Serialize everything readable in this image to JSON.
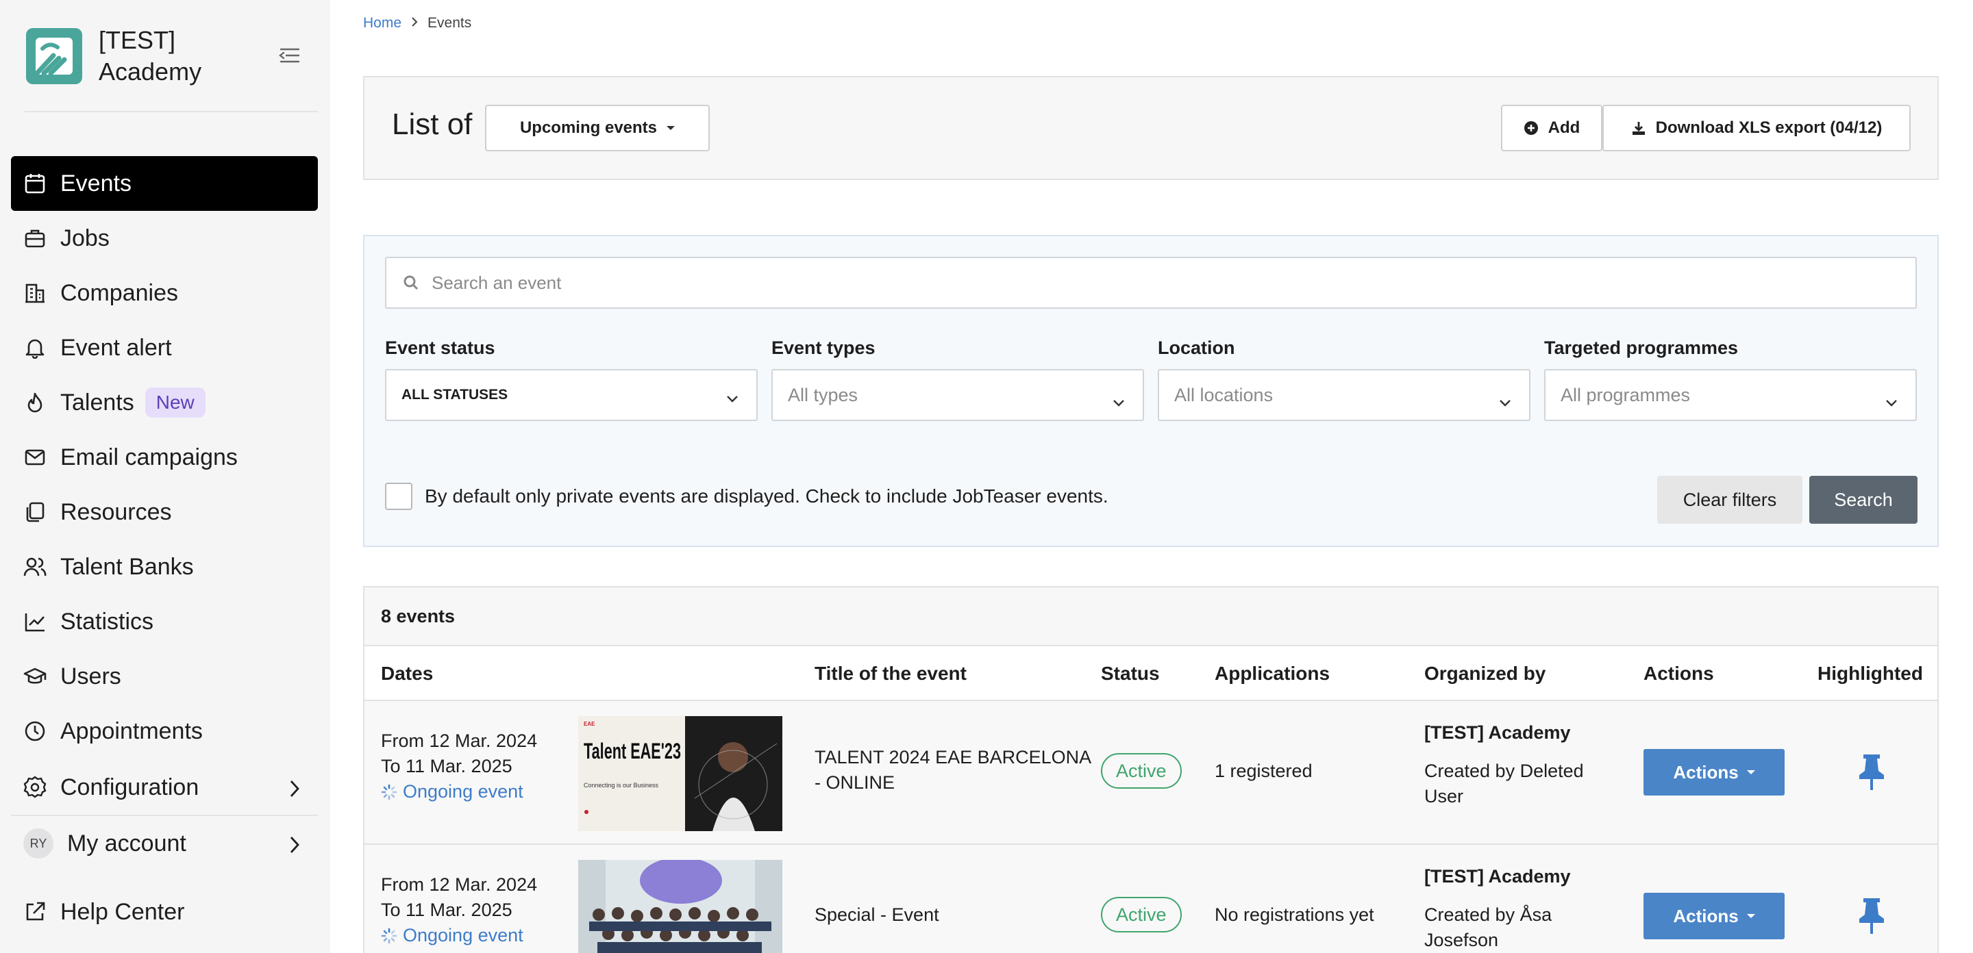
{
  "app": {
    "name": "[TEST] Academy"
  },
  "sidebar": {
    "items": [
      {
        "label": "Events",
        "icon": "calendar-icon",
        "active": true
      },
      {
        "label": "Jobs",
        "icon": "briefcase-icon"
      },
      {
        "label": "Companies",
        "icon": "building-icon"
      },
      {
        "label": "Event alert",
        "icon": "bell-icon"
      },
      {
        "label": "Talents",
        "icon": "flame-icon",
        "badge": "New"
      },
      {
        "label": "Email campaigns",
        "icon": "mail-icon"
      },
      {
        "label": "Resources",
        "icon": "documents-icon"
      },
      {
        "label": "Talent Banks",
        "icon": "users-icon"
      },
      {
        "label": "Statistics",
        "icon": "chart-line-icon"
      },
      {
        "label": "Users",
        "icon": "graduation-cap-icon"
      },
      {
        "label": "Appointments",
        "icon": "clock-icon"
      },
      {
        "label": "Configuration",
        "icon": "gear-icon"
      }
    ],
    "account": {
      "initials": "RY",
      "label": "My account"
    },
    "help": {
      "label": "Help Center",
      "icon": "external-link-icon"
    }
  },
  "breadcrumb": {
    "home": "Home",
    "current": "Events"
  },
  "header": {
    "list_of": "List of",
    "view_selector": "Upcoming events",
    "add_label": "Add",
    "download_label": "Download XLS export (04/12)"
  },
  "filters": {
    "search_placeholder": "Search an event",
    "status": {
      "label": "Event status",
      "value": "ALL STATUSES"
    },
    "types": {
      "label": "Event types",
      "placeholder": "All types"
    },
    "location": {
      "label": "Location",
      "placeholder": "All locations"
    },
    "programmes": {
      "label": "Targeted programmes",
      "placeholder": "All programmes"
    },
    "checkbox_label": "By default only private events are displayed. Check to include JobTeaser events.",
    "clear_label": "Clear filters",
    "search_label": "Search"
  },
  "table": {
    "count": "8 events",
    "columns": [
      "Dates",
      "Title of the event",
      "Status",
      "Applications",
      "Organized by",
      "Actions",
      "Highlighted"
    ],
    "rows": [
      {
        "from": "From 12 Mar. 2024",
        "to": "To 11 Mar. 2025",
        "state": "Ongoing event",
        "title_line1": "TALENT 2024 EAE BARCELONA",
        "title_line2": "- ONLINE",
        "thumb_brand": "EAE",
        "thumb_title": "Talent EAE'23",
        "thumb_sub": "Connecting is our Business",
        "status": "Active",
        "applications": "1 registered",
        "organizer": "[TEST] Academy",
        "created_by_line1": "Created by Deleted",
        "created_by_line2": "User",
        "actions_label": "Actions"
      },
      {
        "from": "From 12 Mar. 2024",
        "to": "To 11 Mar. 2025",
        "state": "Ongoing event",
        "title_line1": "Special - Event",
        "status": "Active",
        "applications": "No registrations yet",
        "organizer": "[TEST] Academy",
        "created_by_line1": "Created by Åsa",
        "created_by_line2": "Josefson",
        "actions_label": "Actions"
      }
    ]
  },
  "colors": {
    "accent": "#4a85c8",
    "active_status": "#3fa56e",
    "brand_logo": "#4aa69a"
  }
}
